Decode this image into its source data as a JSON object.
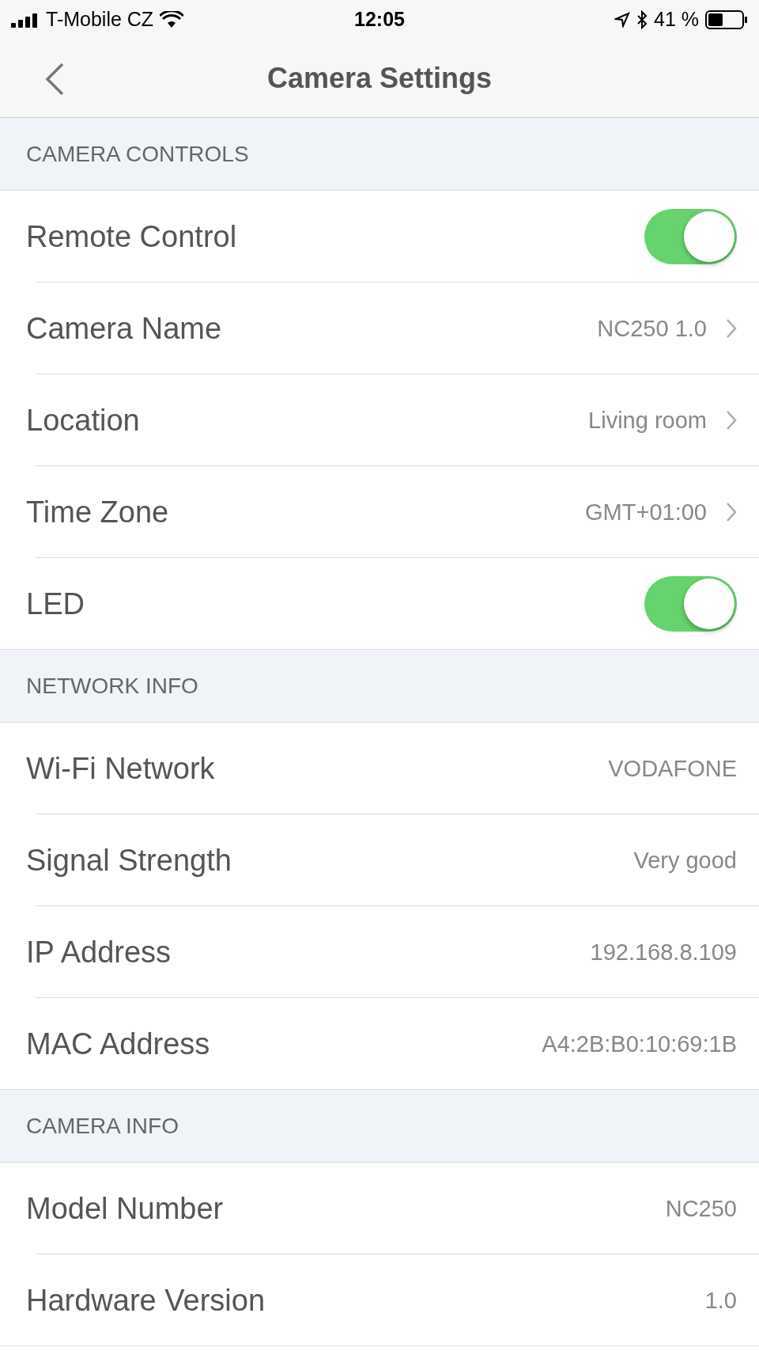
{
  "status_bar": {
    "carrier": "T-Mobile CZ",
    "time": "12:05",
    "battery": "41 %"
  },
  "nav": {
    "title": "Camera Settings"
  },
  "sections": [
    {
      "title": "CAMERA CONTROLS",
      "rows": [
        {
          "kind": "toggle",
          "label": "Remote Control",
          "on": true
        },
        {
          "kind": "link",
          "label": "Camera Name",
          "value": "NC250 1.0"
        },
        {
          "kind": "link",
          "label": "Location",
          "value": "Living room"
        },
        {
          "kind": "link",
          "label": "Time Zone",
          "value": "GMT+01:00"
        },
        {
          "kind": "toggle",
          "label": "LED",
          "on": true
        }
      ]
    },
    {
      "title": "NETWORK INFO",
      "rows": [
        {
          "kind": "info",
          "label": "Wi-Fi Network",
          "value": "VODAFONE"
        },
        {
          "kind": "info",
          "label": "Signal Strength",
          "value": "Very good"
        },
        {
          "kind": "info",
          "label": "IP Address",
          "value": "192.168.8.109"
        },
        {
          "kind": "info",
          "label": "MAC Address",
          "value": "A4:2B:B0:10:69:1B"
        }
      ]
    },
    {
      "title": "CAMERA INFO",
      "rows": [
        {
          "kind": "info",
          "label": "Model Number",
          "value": "NC250"
        },
        {
          "kind": "info",
          "label": "Hardware Version",
          "value": "1.0"
        }
      ]
    }
  ]
}
